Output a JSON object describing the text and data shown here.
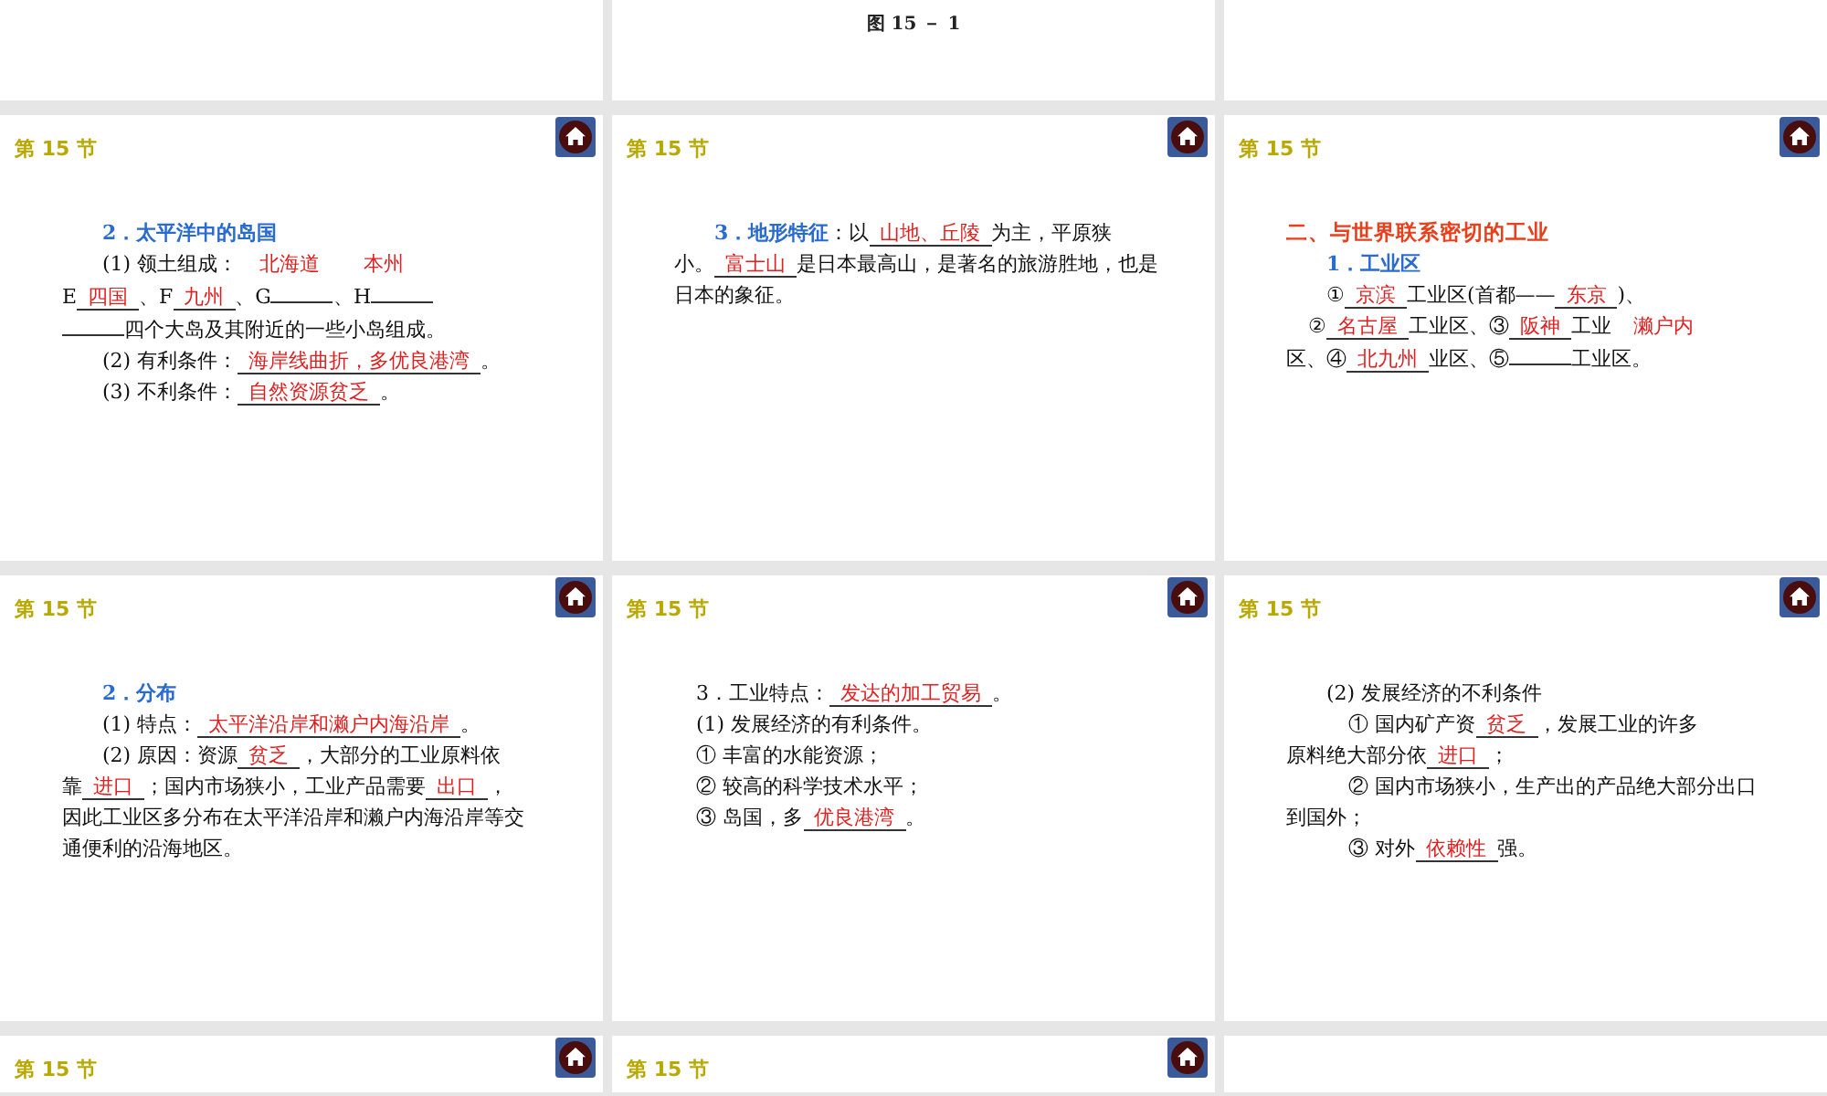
{
  "rows": [
    {
      "slides": [
        {
          "kind": "blank"
        },
        {
          "kind": "figure",
          "caption": "图 15 － 1"
        },
        {
          "kind": "blank"
        }
      ]
    },
    {
      "slides": [
        {
          "kind": "content",
          "header": "第 15 节",
          "lines": [
            {
              "runs": [
                {
                  "kind": "heading",
                  "text": "2．太平洋中的岛国"
                }
              ]
            },
            {
              "runs": [
                {
                  "kind": "text",
                  "text": "(1) 领土组成："
                },
                {
                  "kind": "note",
                  "text": "北海道"
                },
                {
                  "kind": "note",
                  "text": "本州"
                }
              ]
            },
            {
              "runs": [
                {
                  "kind": "text",
                  "text": "E"
                },
                {
                  "kind": "answer",
                  "text": "四国"
                },
                {
                  "kind": "text",
                  "text": "、F"
                },
                {
                  "kind": "answer",
                  "text": "九州"
                },
                {
                  "kind": "text",
                  "text": "、G"
                },
                {
                  "kind": "blank"
                },
                {
                  "kind": "text",
                  "text": "、H"
                },
                {
                  "kind": "blank"
                }
              ]
            },
            {
              "runs": [
                {
                  "kind": "blank"
                },
                {
                  "kind": "text",
                  "text": "四个大岛及其附近的一些小岛组成。"
                }
              ]
            },
            {
              "runs": [
                {
                  "kind": "text",
                  "text": "(2) 有利条件："
                },
                {
                  "kind": "answer",
                  "text": "海岸线曲折，多优良港湾"
                },
                {
                  "kind": "text",
                  "text": "。"
                }
              ]
            },
            {
              "runs": [
                {
                  "kind": "text",
                  "text": "(3) 不利条件："
                },
                {
                  "kind": "answer",
                  "text": "自然资源贫乏"
                },
                {
                  "kind": "text",
                  "text": "。"
                }
              ]
            }
          ]
        },
        {
          "kind": "content",
          "header": "第 15 节",
          "lines": [
            {
              "runs": [
                {
                  "kind": "heading",
                  "text": "3．地形特征"
                },
                {
                  "kind": "text",
                  "text": "：以"
                },
                {
                  "kind": "answer",
                  "text": "山地、丘陵"
                },
                {
                  "kind": "text",
                  "text": "为主，平原狭"
                }
              ]
            },
            {
              "runs": [
                {
                  "kind": "text",
                  "text": "小。"
                },
                {
                  "kind": "answer",
                  "text": "富士山"
                },
                {
                  "kind": "text",
                  "text": "是日本最高山，是著名的旅游胜地，也是"
                }
              ]
            },
            {
              "runs": [
                {
                  "kind": "text",
                  "text": "日本的象征。"
                }
              ]
            }
          ]
        },
        {
          "kind": "content",
          "header": "第 15 节",
          "lines": [
            {
              "runs": [
                {
                  "kind": "title",
                  "text": "二、与世界联系密切的工业"
                }
              ]
            },
            {
              "runs": [
                {
                  "kind": "heading",
                  "text": "1．工业区"
                }
              ]
            },
            {
              "runs": [
                {
                  "kind": "text",
                  "text": "①"
                },
                {
                  "kind": "answer",
                  "text": "京滨"
                },
                {
                  "kind": "text",
                  "text": "工业区(首都——"
                },
                {
                  "kind": "answer",
                  "text": "东京"
                },
                {
                  "kind": "text",
                  "text": ")、"
                }
              ]
            },
            {
              "runs": [
                {
                  "kind": "text",
                  "text": "②"
                },
                {
                  "kind": "answer",
                  "text": "名古屋"
                },
                {
                  "kind": "text",
                  "text": "工业区、③"
                },
                {
                  "kind": "answer",
                  "text": "阪神"
                },
                {
                  "kind": "text",
                  "text": "工业"
                },
                {
                  "kind": "note",
                  "text": "濑户内"
                }
              ]
            },
            {
              "runs": [
                {
                  "kind": "text",
                  "text": "区、④"
                },
                {
                  "kind": "answer",
                  "text": "北九州"
                },
                {
                  "kind": "text",
                  "text": "业区、⑤"
                },
                {
                  "kind": "blank"
                },
                {
                  "kind": "text",
                  "text": "工业区。"
                }
              ]
            }
          ]
        }
      ]
    },
    {
      "slides": [
        {
          "kind": "content",
          "header": "第 15 节",
          "lines": [
            {
              "runs": [
                {
                  "kind": "heading",
                  "text": "2．分布"
                }
              ]
            },
            {
              "runs": [
                {
                  "kind": "text",
                  "text": "(1) 特点："
                },
                {
                  "kind": "answer",
                  "text": "太平洋沿岸和濑户内海沿岸"
                },
                {
                  "kind": "text",
                  "text": "。"
                }
              ]
            },
            {
              "runs": [
                {
                  "kind": "text",
                  "text": "(2) 原因：资源"
                },
                {
                  "kind": "answer",
                  "text": "贫乏"
                },
                {
                  "kind": "text",
                  "text": "，大部分的工业原料依"
                }
              ]
            },
            {
              "runs": [
                {
                  "kind": "text",
                  "text": "靠"
                },
                {
                  "kind": "answer",
                  "text": "进口"
                },
                {
                  "kind": "text",
                  "text": "；国内市场狭小，工业产品需要"
                },
                {
                  "kind": "answer",
                  "text": "出口"
                },
                {
                  "kind": "text",
                  "text": "，"
                }
              ]
            },
            {
              "runs": [
                {
                  "kind": "text",
                  "text": "因此工业区多分布在太平洋沿岸和濑户内海沿岸等交"
                }
              ]
            },
            {
              "runs": [
                {
                  "kind": "text",
                  "text": "通便利的沿海地区。"
                }
              ]
            }
          ]
        },
        {
          "kind": "content",
          "header": "第 15 节",
          "lines": [
            {
              "runs": [
                {
                  "kind": "text",
                  "text": "3．工业特点："
                },
                {
                  "kind": "answer",
                  "text": "发达的加工贸易"
                },
                {
                  "kind": "text",
                  "text": "。"
                }
              ]
            },
            {
              "runs": [
                {
                  "kind": "text",
                  "text": "(1) 发展经济的有利条件。"
                }
              ]
            },
            {
              "runs": [
                {
                  "kind": "text",
                  "text": "① 丰富的水能资源；"
                }
              ]
            },
            {
              "runs": [
                {
                  "kind": "text",
                  "text": "② 较高的科学技术水平；"
                }
              ]
            },
            {
              "runs": [
                {
                  "kind": "text",
                  "text": "③ 岛国，多"
                },
                {
                  "kind": "answer",
                  "text": "优良港湾"
                },
                {
                  "kind": "text",
                  "text": "。"
                }
              ]
            }
          ]
        },
        {
          "kind": "content",
          "header": "第 15 节",
          "lines": [
            {
              "runs": [
                {
                  "kind": "text",
                  "text": "(2) 发展经济的不利条件"
                }
              ]
            },
            {
              "runs": [
                {
                  "kind": "text",
                  "text": "① 国内矿产资"
                },
                {
                  "kind": "answer",
                  "text": "贫乏"
                },
                {
                  "kind": "text",
                  "text": "，发展工业的许多"
                }
              ]
            },
            {
              "runs": [
                {
                  "kind": "text",
                  "text": "原料绝大部分依"
                },
                {
                  "kind": "answer",
                  "text": "进口"
                },
                {
                  "kind": "text",
                  "text": "；"
                }
              ]
            },
            {
              "runs": [
                {
                  "kind": "text",
                  "text": "② 国内市场狭小，生产出的产品绝大部分出口"
                }
              ]
            },
            {
              "runs": [
                {
                  "kind": "text",
                  "text": "到国外；"
                }
              ]
            },
            {
              "runs": [
                {
                  "kind": "text",
                  "text": "③ 对外"
                },
                {
                  "kind": "answer",
                  "text": "依赖性"
                },
                {
                  "kind": "text",
                  "text": "强。"
                }
              ]
            }
          ]
        }
      ]
    },
    {
      "slides": [
        {
          "kind": "content",
          "header": "第 15 节"
        },
        {
          "kind": "content",
          "header": "第 15 节"
        },
        {
          "kind": "blank"
        }
      ]
    }
  ]
}
